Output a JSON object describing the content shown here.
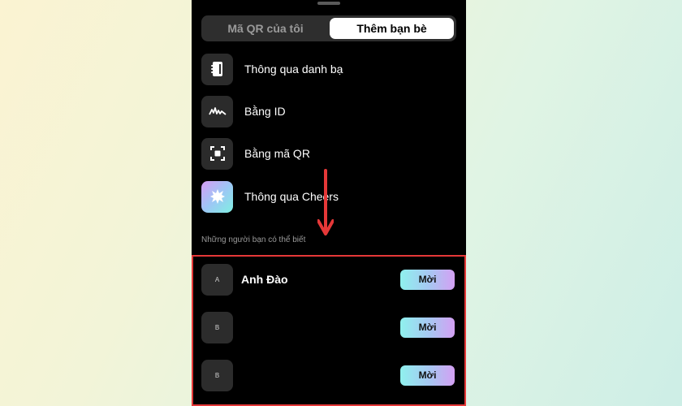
{
  "tabs": {
    "my_qr": "Mã QR của tôi",
    "add_friends": "Thêm bạn bè"
  },
  "methods": [
    {
      "label": "Thông qua danh bạ",
      "icon": "contacts-book-icon"
    },
    {
      "label": "Bằng ID",
      "icon": "id-signature-icon"
    },
    {
      "label": "Bằng mã QR",
      "icon": "qr-scan-icon"
    },
    {
      "label": "Thông qua Cheers",
      "icon": "cheers-badge-icon"
    }
  ],
  "suggestions": {
    "title": "Những người bạn có thể biết",
    "people": [
      {
        "initial": "A",
        "name": "Anh Đào",
        "invite_label": "Mời"
      },
      {
        "initial": "B",
        "name": "",
        "invite_label": "Mời"
      },
      {
        "initial": "B",
        "name": "",
        "invite_label": "Mời"
      }
    ]
  },
  "colors": {
    "annotation_red": "#e53838",
    "invite_gradient_start": "#8ff1ee",
    "invite_gradient_end": "#d4a0f3",
    "screen_background": "#000000"
  }
}
